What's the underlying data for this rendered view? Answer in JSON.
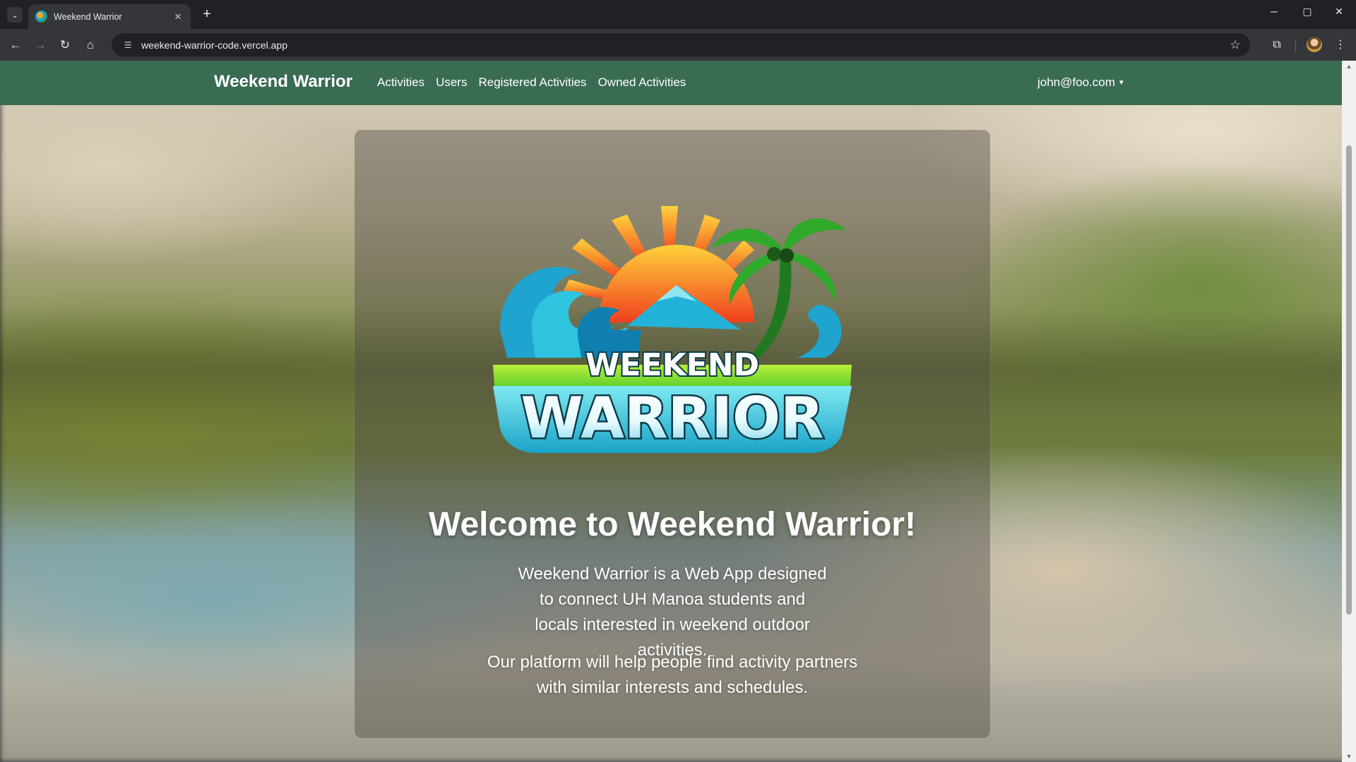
{
  "browser": {
    "tab_title": "Weekend Warrior",
    "tab_close": "✕",
    "new_tab": "+",
    "url": "weekend-warrior-code.vercel.app",
    "window_controls": {
      "minimize": "─",
      "maximize": "▢",
      "close": "✕"
    }
  },
  "navbar": {
    "brand": "Weekend Warrior",
    "links": [
      "Activities",
      "Users",
      "Registered Activities",
      "Owned Activities"
    ],
    "user": "john@foo.com"
  },
  "logo": {
    "line1": "WEEKEND",
    "line2": "WARRIOR"
  },
  "main": {
    "title": "Welcome to Weekend Warrior!",
    "paragraph1": "Weekend Warrior is a Web App designed to connect UH Manoa students and locals interested in weekend outdoor activities.",
    "paragraph2": "Our platform will help people find activity partners with similar interests and schedules."
  },
  "colors": {
    "navbar": "#3a6b53",
    "chrome_dark": "#202124",
    "chrome_toolbar": "#35363a"
  },
  "icons": [
    "tab-list-icon",
    "back-icon",
    "forward-icon",
    "reload-icon",
    "home-icon",
    "site-info-icon",
    "bookmark-star-icon",
    "extensions-icon",
    "menu-dots-icon"
  ]
}
